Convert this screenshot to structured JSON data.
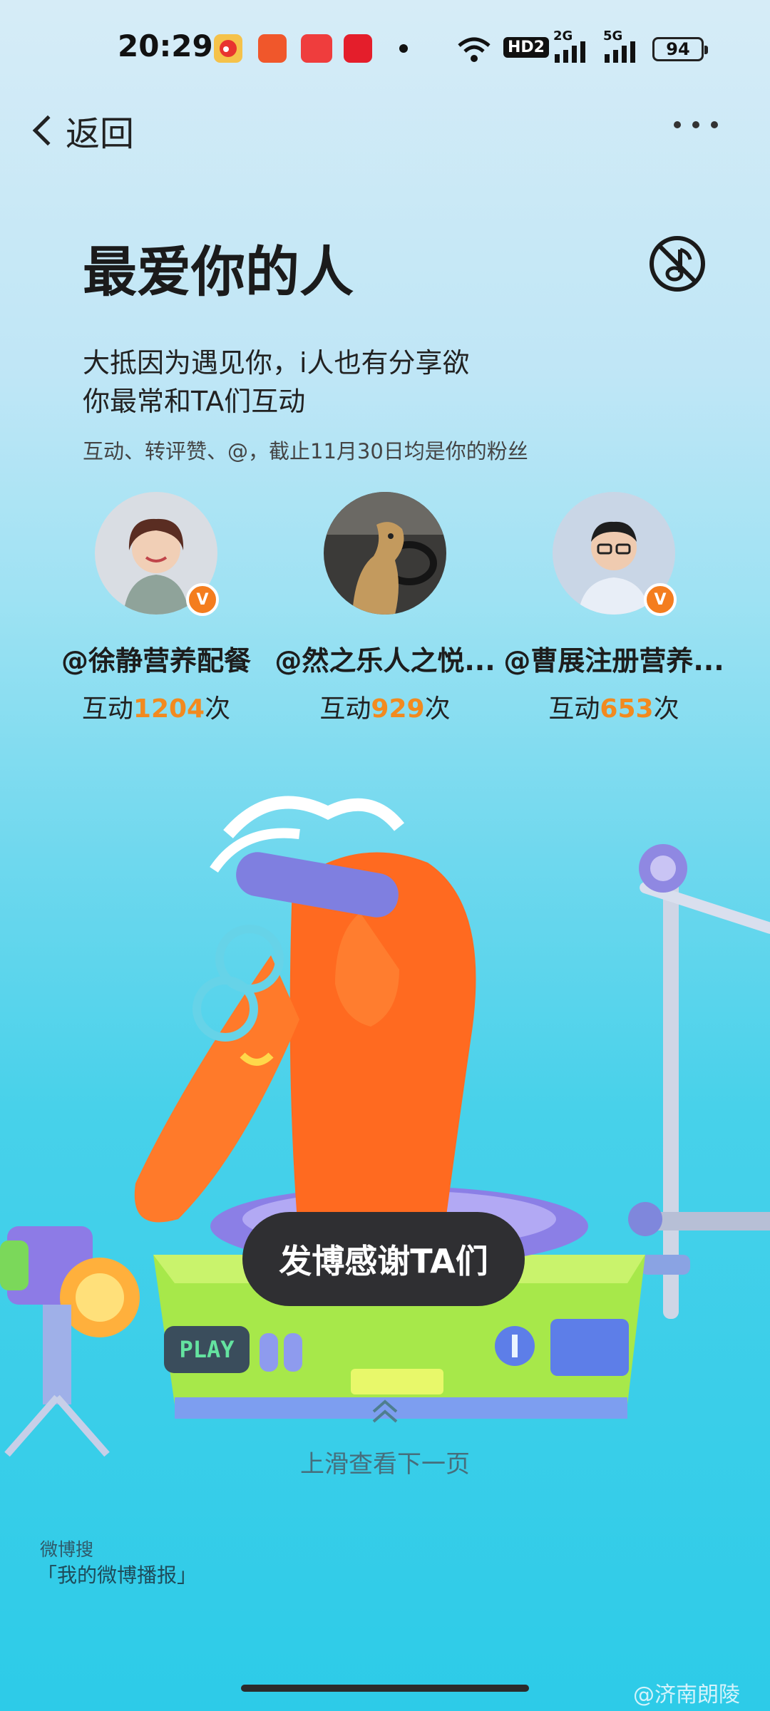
{
  "status_bar": {
    "time": "20:29",
    "network_hd": "HD2",
    "network_2g": "2G",
    "network_5g": "5G",
    "battery": "94"
  },
  "nav": {
    "back_label": "返回"
  },
  "header": {
    "title": "最爱你的人",
    "line1": "大抵因为遇见你，i人也有分享欲",
    "line2": "你最常和TA们互动",
    "note": "互动、转评赞、@，截止11月30日均是你的粉丝"
  },
  "friends": [
    {
      "name": "@徐静营养配餐",
      "count_prefix": "互动",
      "count": "1204",
      "count_suffix": "次",
      "verified": true
    },
    {
      "name": "@然之乐人之悦...",
      "count_prefix": "互动",
      "count": "929",
      "count_suffix": "次",
      "verified": false
    },
    {
      "name": "@曹展注册营养...",
      "count_prefix": "互动",
      "count": "653",
      "count_suffix": "次",
      "verified": true
    }
  ],
  "illustration": {
    "play_text": "PLAY"
  },
  "cta": {
    "label": "发博感谢TA们"
  },
  "swipe": {
    "label": "上滑查看下一页"
  },
  "footer": {
    "search_label": "微博搜",
    "topic_label": "「我的微博播报」",
    "watermark": "@济南朗陵"
  },
  "colors": {
    "accent_orange": "#f28a1f",
    "verified_badge": "#f47d1e",
    "cta_bg": "#2f2f32"
  },
  "icons": [
    "back-chevron-icon",
    "more-icon",
    "no-music-icon",
    "verified-icon",
    "swipe-up-icon",
    "wifi-icon",
    "signal-icon",
    "battery-icon"
  ]
}
